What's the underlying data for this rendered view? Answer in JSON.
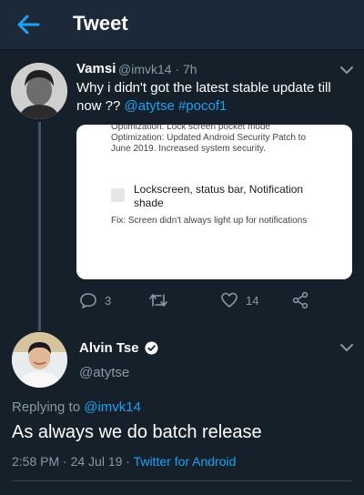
{
  "appbar": {
    "title": "Tweet"
  },
  "reply_tweet": {
    "name": "Vamsi",
    "handle": "@imvk14",
    "time": "· 7h",
    "text": "Why i didn't got the latest stable update till now ??",
    "mention": "@atytse",
    "hashtag": "#pocof1",
    "media": {
      "line1": "Optimization: Lock screen pocket mode",
      "line2": "Optimization: Updated Android Security Patch to",
      "line3": "June 2019. Increased system security.",
      "heading": "Lockscreen, status bar, Notification shade",
      "fix": "Fix: Screen didn't always light up for notifications"
    },
    "actions": {
      "replies": "3",
      "retweets": "",
      "likes": "14"
    }
  },
  "main_tweet": {
    "name": "Alvin Tse",
    "handle": "@atytse",
    "replying_prefix": "Replying to",
    "replying_to": "@imvk14",
    "text": "As always we do batch release",
    "timestamp": "2:58 PM · 24 Jul 19 ·",
    "source": "Twitter for Android"
  },
  "colors": {
    "accent": "#1da1f2",
    "background": "#15202b",
    "muted": "#8899a6"
  }
}
